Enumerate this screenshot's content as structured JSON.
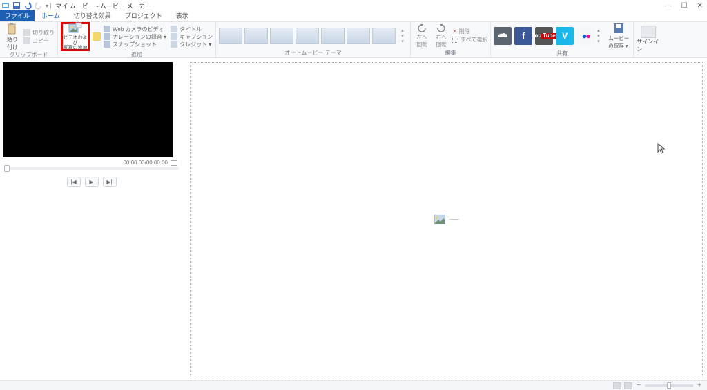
{
  "title": "マイ ムービー - ムービー メーカー",
  "qat_divider": "▾ |",
  "window": {
    "min": "—",
    "max": "☐",
    "close": "✕"
  },
  "tabs": {
    "file": "ファイル",
    "home": "ホーム",
    "animation": "切り替え効果",
    "project": "プロジェクト",
    "view": "表示"
  },
  "ribbon": {
    "clipboard": {
      "paste": "貼り\n付け",
      "cut": "切り取り",
      "copy": "コピー",
      "label": "クリップボード"
    },
    "add": {
      "add_media": "ビデオおよび\n写真の追加",
      "webcam": "Web カメラのビデオ",
      "narration": "ナレーションの録音 ▾",
      "snapshot": "スナップショット",
      "title": "タイトル",
      "caption": "キャプション",
      "credits": "クレジット ▾",
      "label": "追加"
    },
    "automovie": {
      "label": "オートムービー テーマ"
    },
    "edit": {
      "rotate_left": "左へ\n回転",
      "rotate_right": "右へ\n回転",
      "delete": "削除",
      "select_all": "すべて選択",
      "label": "編集"
    },
    "share": {
      "save_movie": "ムービー\nの保存 ▾",
      "label": "共有"
    },
    "signin": "サインイン"
  },
  "preview": {
    "time": "00:00.00/00:00.00",
    "prev": "|◀",
    "play": "▶",
    "next": "▶|"
  },
  "placeholder_dash": "—",
  "zoom": {
    "minus": "−",
    "plus": "+"
  }
}
